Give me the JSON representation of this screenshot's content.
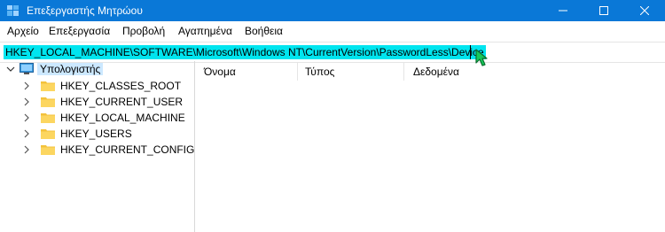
{
  "window": {
    "title": "Επεξεργαστής Μητρώου"
  },
  "colors": {
    "titlebar": "#0a78d7",
    "address_highlight": "#00e5ef",
    "selection": "#cce8ff"
  },
  "menu": [
    "Αρχείο",
    "Επεξεργασία",
    "Προβολή",
    "Αγαπημένα",
    "Βοήθεια"
  ],
  "address": {
    "value": "HKEY_LOCAL_MACHINE\\SOFTWARE\\Microsoft\\Windows NT\\CurrentVersion\\PasswordLess\\Device"
  },
  "tree": {
    "root": "Υπολογιστής",
    "children": [
      "HKEY_CLASSES_ROOT",
      "HKEY_CURRENT_USER",
      "HKEY_LOCAL_MACHINE",
      "HKEY_USERS",
      "HKEY_CURRENT_CONFIG"
    ]
  },
  "list": {
    "columns": [
      "Όνομα",
      "Τύπος",
      "Δεδομένα"
    ]
  },
  "icons": {
    "app": "regedit-icon",
    "computer": "computer-icon",
    "folder": "folder-icon",
    "cursor": "mouse-pointer-icon"
  }
}
